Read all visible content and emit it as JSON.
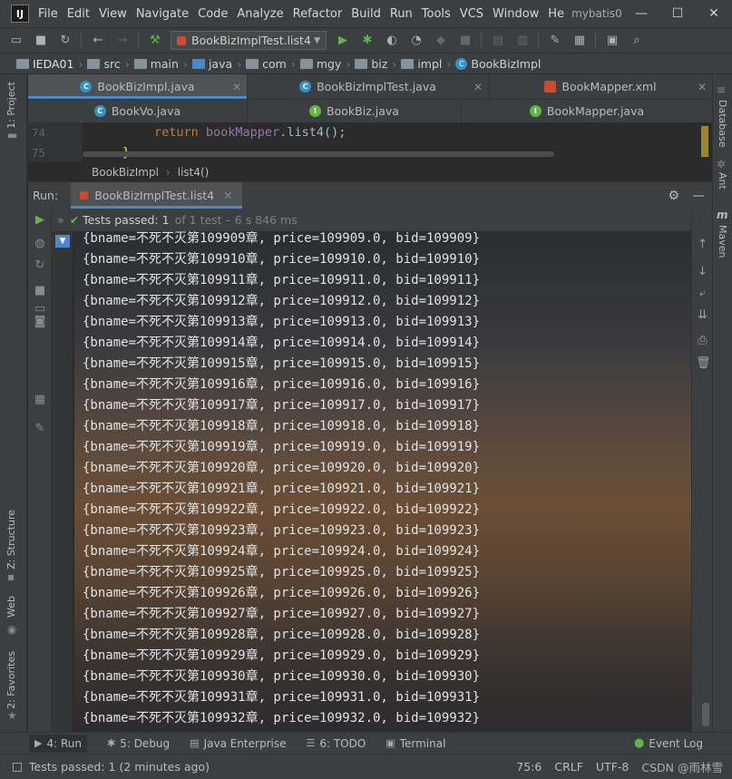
{
  "menubar": {
    "logo": "IJ",
    "items": [
      "File",
      "Edit",
      "View",
      "Navigate",
      "Code",
      "Analyze",
      "Refactor",
      "Build",
      "Run",
      "Tools",
      "VCS",
      "Window",
      "He"
    ],
    "window_title": "mybatis0",
    "minimize": "—",
    "maximize": "☐",
    "close": "✕"
  },
  "toolbar": {
    "run_config": "BookBizImplTest.list4"
  },
  "navbar": {
    "crumbs": [
      "IEDA01",
      "src",
      "main",
      "java",
      "com",
      "mgy",
      "biz",
      "impl",
      "BookBizImpl"
    ]
  },
  "tabs_row1": [
    {
      "label": "BookBizImpl.java",
      "icon": "class-icon",
      "active": true
    },
    {
      "label": "BookBizImplTest.java",
      "icon": "test-class-icon",
      "active": false
    },
    {
      "label": "BookMapper.xml",
      "icon": "xml-icon",
      "active": false
    }
  ],
  "tabs_row2": [
    {
      "label": "BookVo.java",
      "icon": "class-icon"
    },
    {
      "label": "BookBiz.java",
      "icon": "interface-icon"
    },
    {
      "label": "BookMapper.java",
      "icon": "interface-icon"
    }
  ],
  "editor": {
    "line74_num": "74",
    "line75_num": "75",
    "line74_kw": "return ",
    "line74_field": "bookMapper",
    "line74_rest": ".list4();",
    "line75_brace": "}"
  },
  "editor_breadcrumb": {
    "class_name": "BookBizImpl",
    "method": "list4()"
  },
  "left_strip": {
    "project": "1: Project",
    "structure": "Z: Structure",
    "web": "Web",
    "favorites": "2: Favorites"
  },
  "right_strip": {
    "database": "Database",
    "ant": "Ant",
    "maven": "Maven"
  },
  "run_panel": {
    "label": "Run:",
    "tab": "BookBizImplTest.list4",
    "tests_passed": "Tests passed: 1",
    "tests_detail": "of 1 test – 6 s 846 ms"
  },
  "console_lines": [
    "{bname=不死不灭第109909章, price=109909.0, bid=109909}",
    "{bname=不死不灭第109910章, price=109910.0, bid=109910}",
    "{bname=不死不灭第109911章, price=109911.0, bid=109911}",
    "{bname=不死不灭第109912章, price=109912.0, bid=109912}",
    "{bname=不死不灭第109913章, price=109913.0, bid=109913}",
    "{bname=不死不灭第109914章, price=109914.0, bid=109914}",
    "{bname=不死不灭第109915章, price=109915.0, bid=109915}",
    "{bname=不死不灭第109916章, price=109916.0, bid=109916}",
    "{bname=不死不灭第109917章, price=109917.0, bid=109917}",
    "{bname=不死不灭第109918章, price=109918.0, bid=109918}",
    "{bname=不死不灭第109919章, price=109919.0, bid=109919}",
    "{bname=不死不灭第109920章, price=109920.0, bid=109920}",
    "{bname=不死不灭第109921章, price=109921.0, bid=109921}",
    "{bname=不死不灭第109922章, price=109922.0, bid=109922}",
    "{bname=不死不灭第109923章, price=109923.0, bid=109923}",
    "{bname=不死不灭第109924章, price=109924.0, bid=109924}",
    "{bname=不死不灭第109925章, price=109925.0, bid=109925}",
    "{bname=不死不灭第109926章, price=109926.0, bid=109926}",
    "{bname=不死不灭第109927章, price=109927.0, bid=109927}",
    "{bname=不死不灭第109928章, price=109928.0, bid=109928}",
    "{bname=不死不灭第109929章, price=109929.0, bid=109929}",
    "{bname=不死不灭第109930章, price=109930.0, bid=109930}",
    "{bname=不死不灭第109931章, price=109931.0, bid=109931}",
    "{bname=不死不灭第109932章, price=109932.0, bid=109932}"
  ],
  "bottom_bar": {
    "run": "4: Run",
    "debug": "5: Debug",
    "java_enterprise": "Java Enterprise",
    "todo": "6: TODO",
    "terminal": "Terminal",
    "event_log": "Event Log"
  },
  "status_bar": {
    "message": "Tests passed: 1 (2 minutes ago)",
    "position": "75:6",
    "line_sep": "CRLF",
    "encoding": "UTF-8",
    "watermark": "CSDN @雨林雪"
  },
  "colors": {
    "accent": "#4a88c7",
    "success": "#62b543",
    "keyword": "#cc7832",
    "field": "#9876aa"
  }
}
